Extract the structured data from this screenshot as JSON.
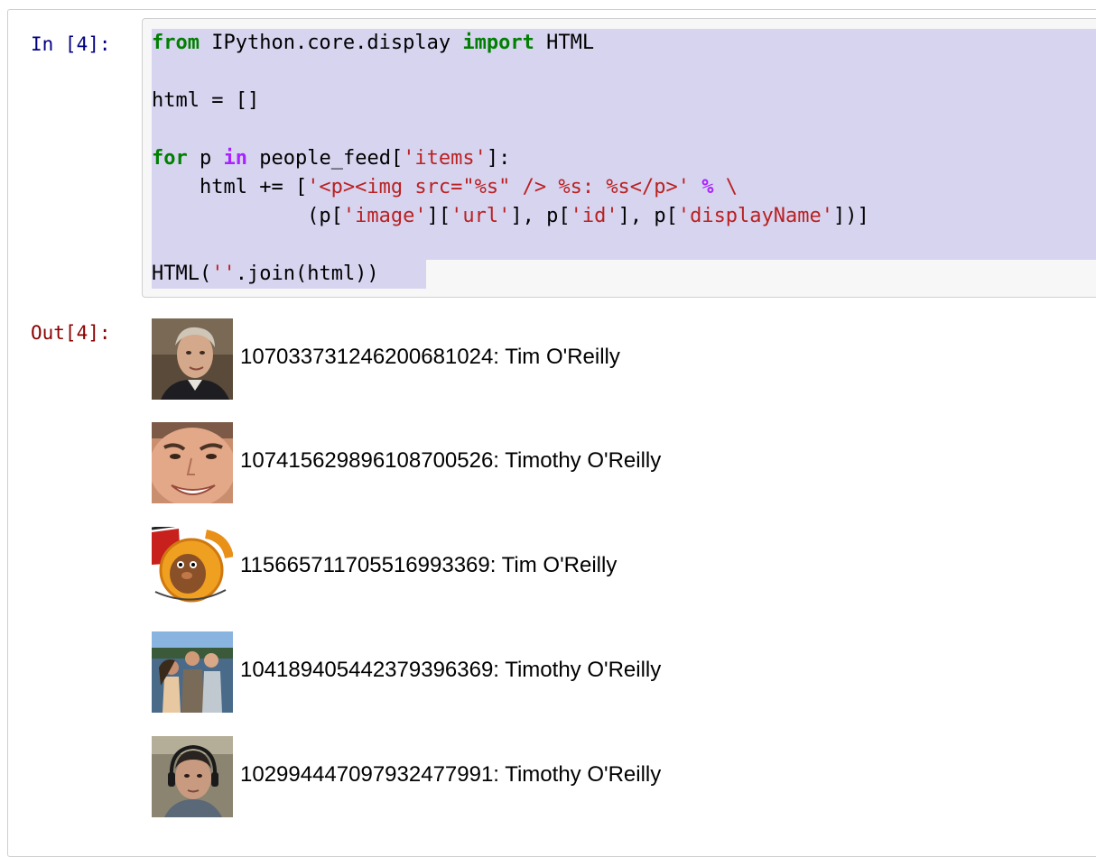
{
  "cell": {
    "in_prompt": "In [4]:",
    "out_prompt": "Out[4]:",
    "code_lines": [
      [
        {
          "t": "from",
          "c": "kw"
        },
        {
          "t": " IPython.core.display ",
          "c": ""
        },
        {
          "t": "import",
          "c": "kw"
        },
        {
          "t": " HTML",
          "c": ""
        }
      ],
      [],
      [
        {
          "t": "html = []",
          "c": ""
        }
      ],
      [],
      [
        {
          "t": "for",
          "c": "kw"
        },
        {
          "t": " p ",
          "c": ""
        },
        {
          "t": "in",
          "c": "op"
        },
        {
          "t": " people_feed[",
          "c": ""
        },
        {
          "t": "'items'",
          "c": "str"
        },
        {
          "t": "]:",
          "c": ""
        }
      ],
      [
        {
          "t": "    html += [",
          "c": ""
        },
        {
          "t": "'<p><img src=\"%s\" /> %s: %s</p>'",
          "c": "str"
        },
        {
          "t": " ",
          "c": ""
        },
        {
          "t": "%",
          "c": "op"
        },
        {
          "t": " \\",
          "c": "str"
        }
      ],
      [
        {
          "t": "             (p[",
          "c": ""
        },
        {
          "t": "'image'",
          "c": "str"
        },
        {
          "t": "][",
          "c": ""
        },
        {
          "t": "'url'",
          "c": "str"
        },
        {
          "t": "], p[",
          "c": ""
        },
        {
          "t": "'id'",
          "c": "str"
        },
        {
          "t": "], p[",
          "c": ""
        },
        {
          "t": "'displayName'",
          "c": "str"
        },
        {
          "t": "])]",
          "c": ""
        }
      ],
      [],
      [
        {
          "t": "HTML(",
          "c": ""
        },
        {
          "t": "''",
          "c": "str"
        },
        {
          "t": ".join(html))",
          "c": ""
        }
      ]
    ]
  },
  "output": {
    "people": [
      {
        "id": "107033731246200681024",
        "name": "Tim O'Reilly",
        "line": "107033731246200681024: Tim O'Reilly",
        "image": "portrait-older-man-icon"
      },
      {
        "id": "107415629896108700526",
        "name": "Timothy O'Reilly",
        "line": "107415629896108700526: Timothy O'Reilly",
        "image": "smiling-face-closeup-icon"
      },
      {
        "id": "115665711705516993369",
        "name": "Tim O'Reilly",
        "line": "115665711705516993369: Tim O'Reilly",
        "image": "cartoon-squirrel-logo-icon"
      },
      {
        "id": "104189405442379396369",
        "name": "Timothy O'Reilly",
        "line": "104189405442379396369: Timothy O'Reilly",
        "image": "group-lake-photo-icon"
      },
      {
        "id": "102994447097932477991",
        "name": "Timothy O'Reilly",
        "line": "102994447097932477991: Timothy O'Reilly",
        "image": "headphones-portrait-icon"
      }
    ]
  },
  "colors": {
    "in_prompt": "#000080",
    "out_prompt": "#8b0000",
    "keyword": "#008000",
    "operator": "#aa22ff",
    "string": "#ba2121",
    "selection": "#d7d4f0"
  }
}
